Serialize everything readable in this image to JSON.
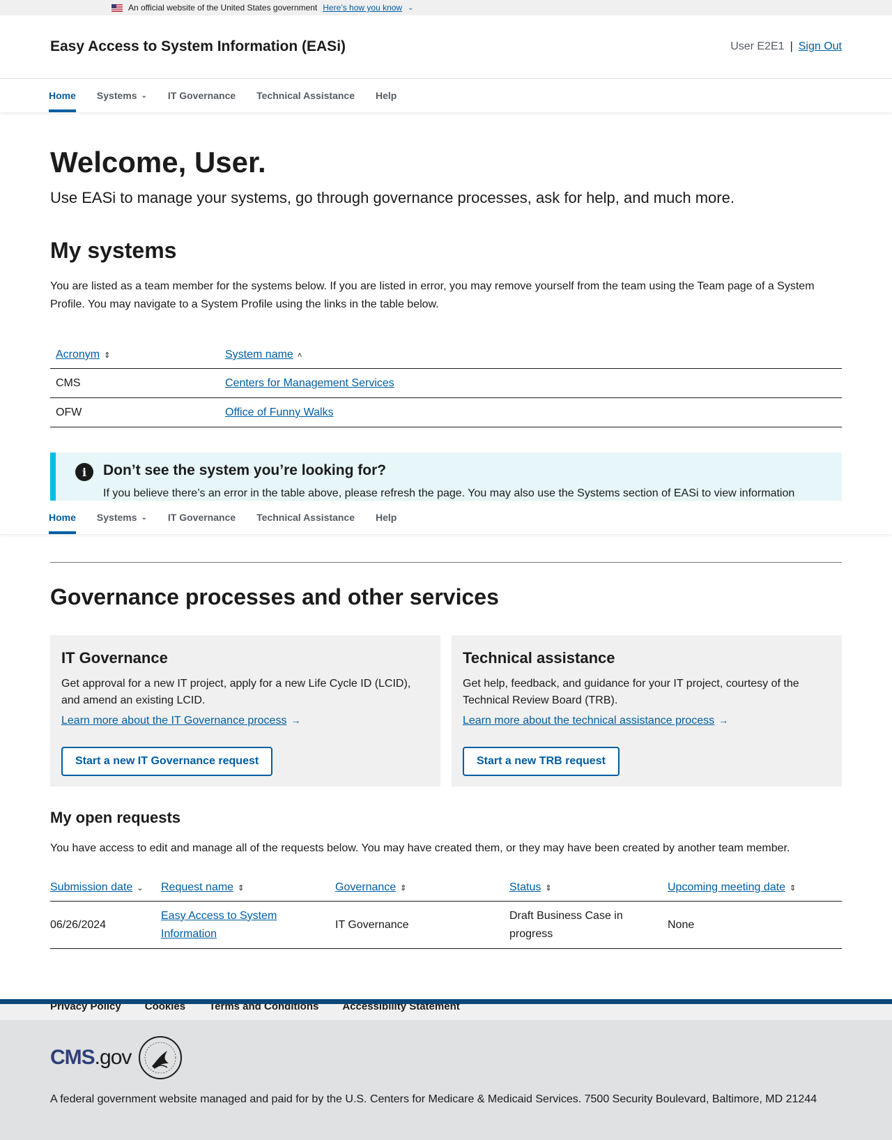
{
  "banner": {
    "text": "An official website of the United States government",
    "how_link": "Here’s how you know"
  },
  "header": {
    "title": "Easy Access to System Information (EASi)",
    "user": "User E2E1",
    "separator": "|",
    "sign_out": "Sign Out"
  },
  "nav": {
    "items": [
      {
        "label": "Home",
        "active": true
      },
      {
        "label": "Systems",
        "dropdown": true
      },
      {
        "label": "IT Governance"
      },
      {
        "label": "Technical Assistance"
      },
      {
        "label": "Help"
      }
    ]
  },
  "welcome": {
    "title": "Welcome, User.",
    "lead": "Use EASi to manage your systems, go through governance processes, ask for help, and much more."
  },
  "my_systems": {
    "title": "My systems",
    "description": "You are listed as a team member for the systems below. If you are listed in error, you may remove yourself from the team using the Team page of a System Profile. You may navigate to a System Profile using the links in the table below.",
    "columns": [
      "Acronym",
      "System name"
    ],
    "rows": [
      {
        "acronym": "CMS",
        "name": "Centers for Management Services"
      },
      {
        "acronym": "OFW",
        "name": "Office of Funny Walks"
      }
    ]
  },
  "alert": {
    "title": "Don’t see the system you’re looking for?",
    "body": "If you believe there’s an error in the table above, please refresh the page. You may also use the Systems section of EASi to view information"
  },
  "governance": {
    "title": "Governance processes and other services",
    "cards": [
      {
        "title": "IT Governance",
        "body": "Get approval for a new IT project, apply for a new Life Cycle ID (LCID), and amend an existing LCID.",
        "link": "Learn more about the IT Governance process",
        "button": "Start a new IT Governance request"
      },
      {
        "title": "Technical assistance",
        "body": "Get help, feedback, and guidance for your IT project, courtesy of the Technical Review Board (TRB).",
        "link": "Learn more about the technical assistance process",
        "button": "Start a new TRB request"
      }
    ]
  },
  "open_requests": {
    "title": "My open requests",
    "description": "You have access to edit and manage all of the requests below. You may have created them, or they may have been created by another team member.",
    "columns": [
      "Submission date",
      "Request name",
      "Governance",
      "Status",
      "Upcoming meeting date"
    ],
    "rows": [
      {
        "date": "06/26/2024",
        "name": "Easy Access to System Information",
        "governance": "IT Governance",
        "status": "Draft Business Case in progress",
        "meeting": "None"
      }
    ]
  },
  "footer": {
    "links": [
      "Privacy Policy",
      "Cookies",
      "Terms and Conditions",
      "Accessibility Statement"
    ],
    "logo_cms": "CMS",
    "logo_gov": ".gov",
    "text": "A federal government website managed and paid for by the U.S. Centers for Medicare & Medicaid Services. 7500 Security Boulevard, Baltimore, MD 21244"
  },
  "colors": {
    "primary": "#005ea2",
    "alert_bg": "#e7f6f8",
    "alert_border": "#00bde3",
    "footer_dark": "#0b4778"
  }
}
